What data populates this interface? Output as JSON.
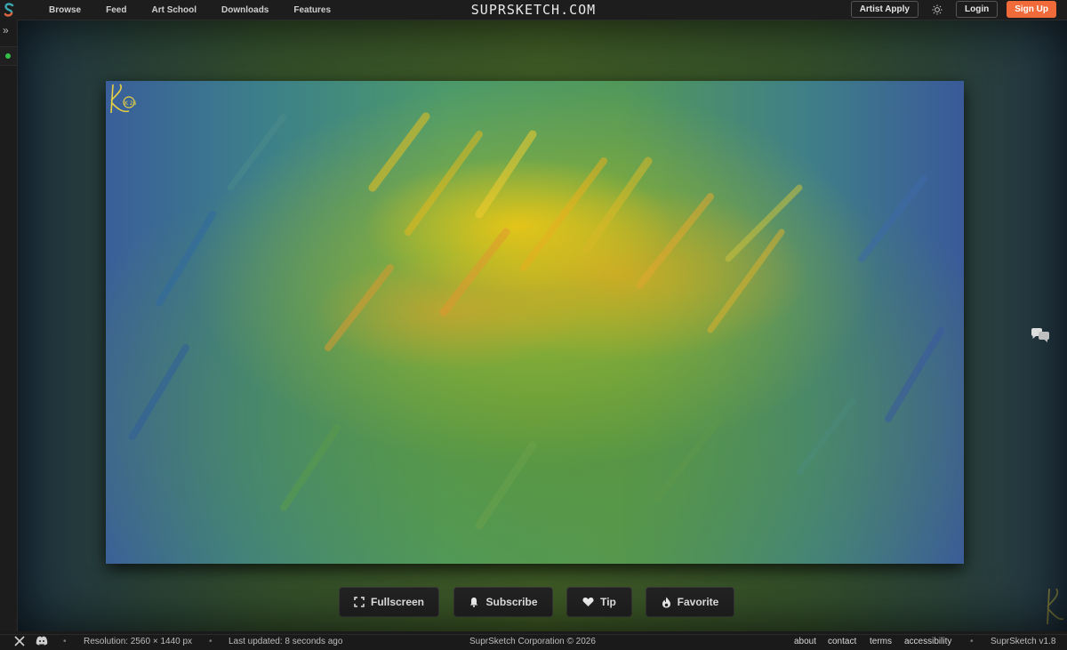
{
  "nav": {
    "logo": "suprsketch-logo",
    "items": [
      {
        "label": "Browse"
      },
      {
        "label": "Feed"
      },
      {
        "label": "Art School"
      },
      {
        "label": "Downloads"
      },
      {
        "label": "Features"
      }
    ],
    "brand": "SUPRSKETCH.COM",
    "artist_apply": "Artist Apply",
    "theme_icon": "sun-icon",
    "login": "Login",
    "signup": "Sign Up"
  },
  "rail": {
    "expand_icon": "double-chevron-right-icon",
    "status_color": "#35c04a"
  },
  "artwork": {
    "signature": "K 26"
  },
  "actions": {
    "fullscreen": "Fullscreen",
    "subscribe": "Subscribe",
    "tip": "Tip",
    "favorite": "Favorite"
  },
  "side": {
    "chat_icon": "chat-bubbles-icon"
  },
  "footer": {
    "resolution": "Resolution: 2560 × 1440 px",
    "updated": "Last updated: 8 seconds ago",
    "copyright": "SuprSketch Corporation © 2026",
    "links": [
      "about",
      "contact",
      "terms",
      "accessibility"
    ],
    "version": "SuprSketch v1.8"
  },
  "colors": {
    "accent": "#f06a3a",
    "background": "#1a1a1a"
  }
}
